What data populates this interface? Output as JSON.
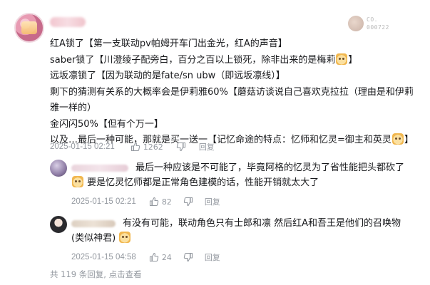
{
  "comment": {
    "lines": [
      "红A锁了【第一支联动pv帕姆开车门出金光，红A的声音】",
      "saber锁了【川澄绫子配旁白，百分之百以上锁死，除非出来的是梅莉",
      "远坂凛锁了【因为联动的是fate/sn ubw（即远坂凛线）",
      "剩下的猜测有关系的大概率会是伊莉雅60%【蘑菇访谈说自己喜欢克拉拉（理由是和伊莉",
      "雅一样的）",
      "金闪闪50%【但有个万一",
      "以及…最后一种可能，那就是买一送一【记忆命途的特点：忆师和忆灵=御主和英灵"
    ],
    "line_tails": [
      "",
      "】",
      "】",
      "",
      "",
      "】",
      "】"
    ],
    "time": "2025-01-15 02:21",
    "likes": "1262",
    "reply_label": "回复"
  },
  "badge": {
    "text": "CO.\n000722"
  },
  "replies": [
    {
      "lines": [
        "最后一种应该是不可能了，毕竟阿格的忆灵为了省性能把头都砍了",
        "要是忆灵忆师都是正常角色建模的话，性能开销就太大了"
      ],
      "time": "2025-01-15 02:21",
      "likes": "82",
      "reply_label": "回复"
    },
    {
      "lines": [
        "有没有可能，联动角色只有士郎和凛 然后红A和吾王是他们的召唤物",
        "(类似神君)"
      ],
      "time": "2025-01-15 04:58",
      "likes": "24",
      "reply_label": "回复"
    }
  ],
  "footer": {
    "count_text": "共 119 条回复,",
    "more_label": "点击查看"
  },
  "icons": {
    "like": "thumbs-up-icon",
    "dislike": "thumbs-down-icon",
    "emoji": "cat-sticker-icon"
  },
  "colors": {
    "text": "#18191c",
    "meta": "#9499a0"
  }
}
